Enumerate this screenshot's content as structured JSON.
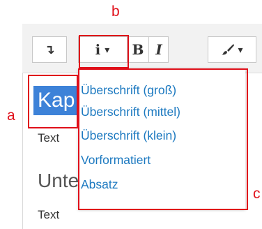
{
  "toolbar": {
    "buttons": [
      {
        "name": "arrow-down-icon",
        "glyph": "↴"
      },
      {
        "name": "info-paragraph-icon",
        "glyph": "i",
        "has_dropdown": true
      },
      {
        "name": "bold-icon",
        "glyph": "B"
      },
      {
        "name": "italic-icon",
        "glyph": "I"
      },
      {
        "name": "brush-icon",
        "glyph": "🖌",
        "has_dropdown": true
      }
    ],
    "dropdown_caret": "▾"
  },
  "content": {
    "heading1_selected": "Kap",
    "text1": "Text",
    "heading2": "Unte",
    "text2": "Text"
  },
  "dropdown": {
    "items": [
      "Überschrift (groß)",
      "Überschrift (mittel)",
      "Überschrift (klein)",
      "Vorformatiert",
      "Absatz"
    ]
  },
  "annotations": {
    "a": "a",
    "b": "b",
    "c": "c"
  },
  "colors": {
    "annotation_red": "#e0101a",
    "link_blue": "#1c79c0",
    "selection_blue": "#3d82d8"
  }
}
